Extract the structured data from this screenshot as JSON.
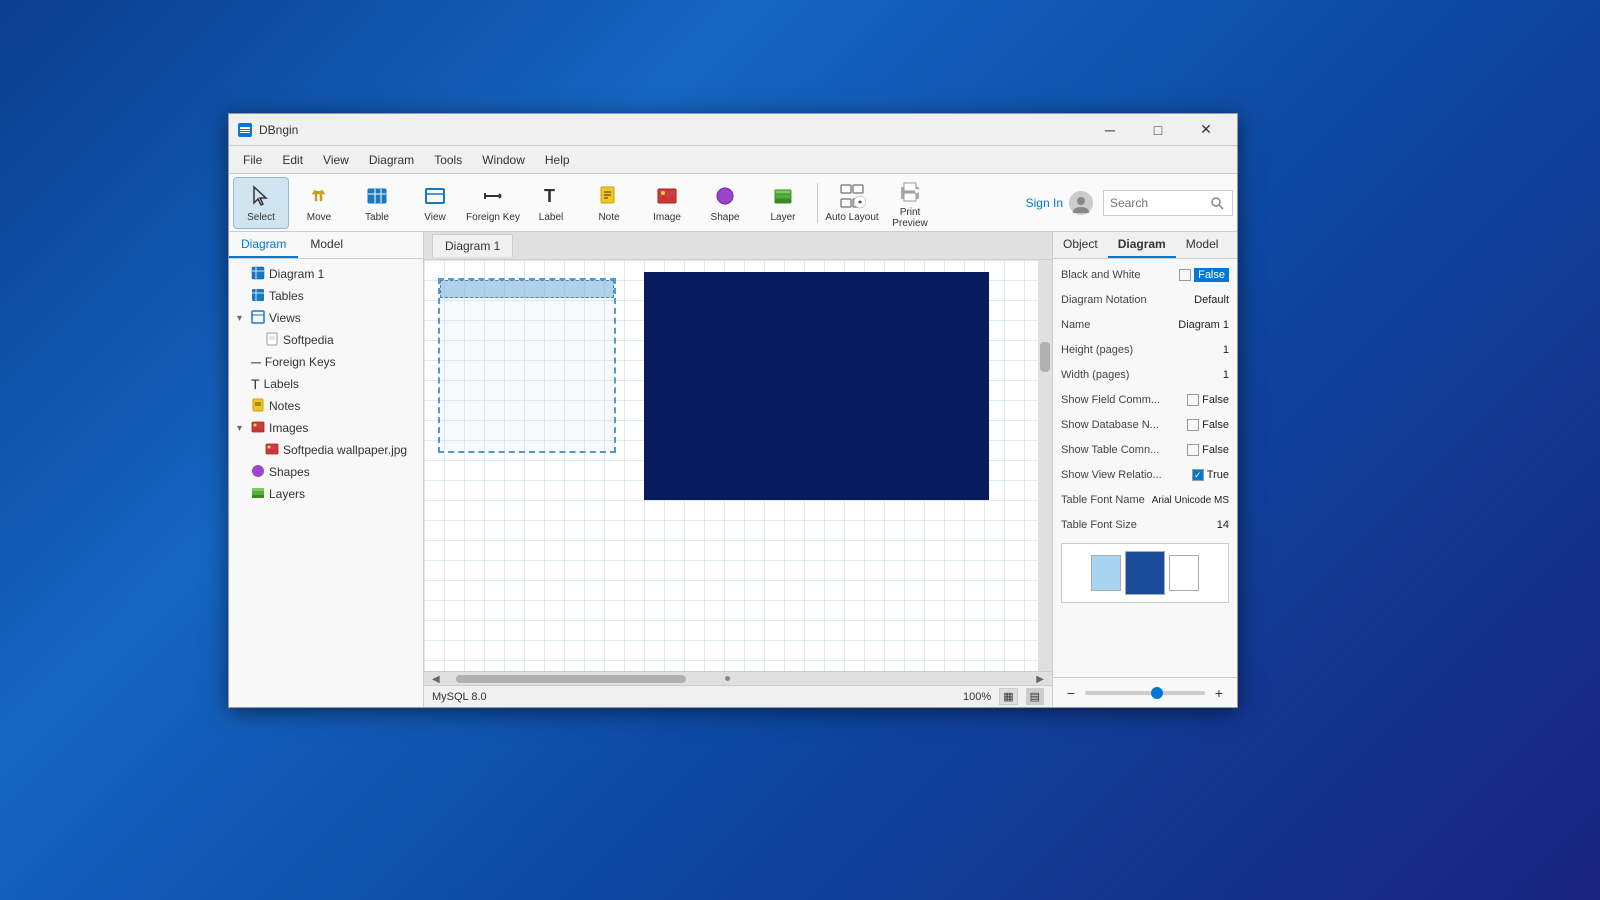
{
  "window": {
    "title": "DBngin",
    "icon": "🗄"
  },
  "titlebar": {
    "minimize": "─",
    "maximize": "□",
    "close": "✕"
  },
  "menubar": {
    "items": [
      "File",
      "Edit",
      "View",
      "Diagram",
      "Tools",
      "Window",
      "Help"
    ]
  },
  "toolbar": {
    "buttons": [
      {
        "id": "select",
        "label": "Select",
        "icon": "↖",
        "active": true
      },
      {
        "id": "move",
        "label": "Move",
        "icon": "✋"
      },
      {
        "id": "table",
        "label": "Table",
        "icon": "⊞"
      },
      {
        "id": "view",
        "label": "View",
        "icon": "⬜"
      },
      {
        "id": "foreign-key",
        "label": "Foreign Key",
        "icon": "⟶"
      },
      {
        "id": "label",
        "label": "Label",
        "icon": "T"
      },
      {
        "id": "note",
        "label": "Note",
        "icon": "📝"
      },
      {
        "id": "image",
        "label": "Image",
        "icon": "🖼"
      },
      {
        "id": "shape",
        "label": "Shape",
        "icon": "◆"
      },
      {
        "id": "layer",
        "label": "Layer",
        "icon": "📋"
      },
      {
        "id": "auto-layout",
        "label": "Auto Layout",
        "icon": "⟳"
      },
      {
        "id": "print-preview",
        "label": "Print Preview",
        "icon": "🖨"
      }
    ],
    "search_placeholder": "Search"
  },
  "signin": {
    "label": "Sign In"
  },
  "sidebar": {
    "tabs": [
      {
        "id": "diagram",
        "label": "Diagram",
        "active": true
      },
      {
        "id": "model",
        "label": "Model"
      }
    ],
    "tree": [
      {
        "label": "Diagram 1",
        "icon": "📊",
        "indent": 0,
        "has_chevron": false
      },
      {
        "label": "Tables",
        "icon": "🗃",
        "indent": 0,
        "has_chevron": false
      },
      {
        "label": "Views",
        "icon": "👁",
        "indent": 0,
        "has_chevron": true,
        "expanded": true
      },
      {
        "label": "Softpedia",
        "icon": "📄",
        "indent": 1,
        "has_chevron": false
      },
      {
        "label": "Foreign Keys",
        "icon": "🔑",
        "indent": 0,
        "has_chevron": false
      },
      {
        "label": "Labels",
        "icon": "T",
        "indent": 0,
        "has_chevron": false
      },
      {
        "label": "Notes",
        "icon": "📝",
        "indent": 0,
        "has_chevron": false
      },
      {
        "label": "Images",
        "icon": "🖼",
        "indent": 0,
        "has_chevron": true,
        "expanded": true
      },
      {
        "label": "Softpedia wallpaper.jpg",
        "icon": "🖼",
        "indent": 1,
        "has_chevron": false
      },
      {
        "label": "Shapes",
        "icon": "◆",
        "indent": 0,
        "has_chevron": false
      },
      {
        "label": "Layers",
        "icon": "📋",
        "indent": 0,
        "has_chevron": false
      }
    ]
  },
  "canvas": {
    "tab": "Diagram 1"
  },
  "props": {
    "tabs": [
      {
        "id": "object",
        "label": "Object"
      },
      {
        "id": "diagram",
        "label": "Diagram",
        "active": true
      },
      {
        "id": "model",
        "label": "Model"
      }
    ],
    "rows": [
      {
        "label": "Black and White",
        "value": "False",
        "type": "checkbox_false",
        "value_colored": true
      },
      {
        "label": "Diagram Notation",
        "value": "Default",
        "type": "text"
      },
      {
        "label": "Name",
        "value": "Diagram 1",
        "type": "text"
      },
      {
        "label": "Height (pages)",
        "value": "1",
        "type": "text"
      },
      {
        "label": "Width (pages)",
        "value": "1",
        "type": "text"
      },
      {
        "label": "Show Field Comm...",
        "value": "False",
        "type": "checkbox_false"
      },
      {
        "label": "Show Database N...",
        "value": "False",
        "type": "checkbox_false"
      },
      {
        "label": "Show Table Comn...",
        "value": "False",
        "type": "checkbox_false"
      },
      {
        "label": "Show View Relatio...",
        "value": "True",
        "type": "checkbox_true"
      },
      {
        "label": "Table Font Name",
        "value": "Arial Unicode MS",
        "type": "text"
      },
      {
        "label": "Table Font Size",
        "value": "14",
        "type": "text"
      }
    ]
  },
  "statusbar": {
    "db": "MySQL 8.0",
    "zoom": "100%",
    "grid_icon1": "▦",
    "grid_icon2": "▤"
  }
}
